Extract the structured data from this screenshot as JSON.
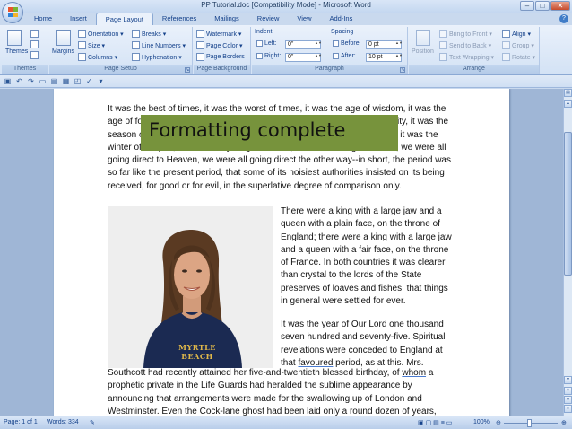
{
  "window": {
    "title": "PP Tutorial.doc [Compatibility Mode] - Microsoft Word",
    "controls": [
      "–",
      "□",
      "✕"
    ]
  },
  "tabs": [
    "Home",
    "Insert",
    "Page Layout",
    "References",
    "Mailings",
    "Review",
    "View",
    "Add-Ins"
  ],
  "active_tab": "Page Layout",
  "ribbon": {
    "themes": {
      "label": "Themes",
      "btn": "Themes"
    },
    "page_setup": {
      "label": "Page Setup",
      "margins": "Margins",
      "orientation": "Orientation ▾",
      "size": "Size ▾",
      "columns": "Columns ▾",
      "breaks": "Breaks ▾",
      "line_numbers": "Line Numbers ▾",
      "hyphenation": "Hyphenation ▾"
    },
    "page_background": {
      "label": "Page Background",
      "watermark": "Watermark ▾",
      "page_color": "Page Color ▾",
      "page_borders": "Page Borders"
    },
    "paragraph": {
      "label": "Paragraph",
      "indent": "Indent",
      "left_label": "Left:",
      "left_value": "0\"",
      "right_label": "Right:",
      "right_value": "0\"",
      "spacing": "Spacing",
      "before_label": "Before:",
      "before_value": "0 pt",
      "after_label": "After:",
      "after_value": "10 pt"
    },
    "arrange": {
      "label": "Arrange",
      "position": "Position",
      "bring_to_front": "Bring to Front ▾",
      "send_to_back": "Send to Back ▾",
      "text_wrapping": "Text Wrapping ▾",
      "align": "Align ▾",
      "group": "Group ▾",
      "rotate": "Rotate ▾"
    }
  },
  "document": {
    "p1": "It was the best of times, it was the worst of times, it was the age of wisdom, it was the age of foolishness, it was the epoch of belief, it was the epoch of incredulity, it was the season of Light, it was the season of Darkness, it was the spring of hope, it was the winter of despair, we had everything before us, we had nothing before us, we were all going direct to Heaven, we were all going direct the other way--in short, the period was so far like the present period, that some of its noisiest authorities insisted on its being received, for good or for evil, in the superlative degree of comparison only.",
    "p2": "There were a king with a large jaw and a queen with a plain face, on the throne of England; there were a king with a large jaw and a queen with a fair face, on the throne of France. In both countries it was clearer than crystal to the lords of the State preserves of loaves and fishes, that things in general were settled for ever.",
    "p3_a": "It was the year of Our Lord one thousand seven hundred and seventy-five. Spiritual revelations were conceded to England at that ",
    "p3_u": "favoured",
    "p3_b": " period, as at this. Mrs.",
    "p4_a": "Southcott had recently attained her five-and-twentieth blessed birthday, of ",
    "p4_u": "whom",
    "p4_b": " a prophetic private in the Life Guards had heralded the sublime appearance by announcing that arrangements were made for the swallowing up of London and Westminster.  Even the Cock-lane ghost had been laid only a round dozen of years,",
    "photo_shirt_text": "MYRTLE BEACH"
  },
  "banner": {
    "text": "Formatting complete",
    "color": "#77933c"
  },
  "status": {
    "page": "Page: 1 of 1",
    "words": "Words: 334",
    "zoom": "100%"
  }
}
